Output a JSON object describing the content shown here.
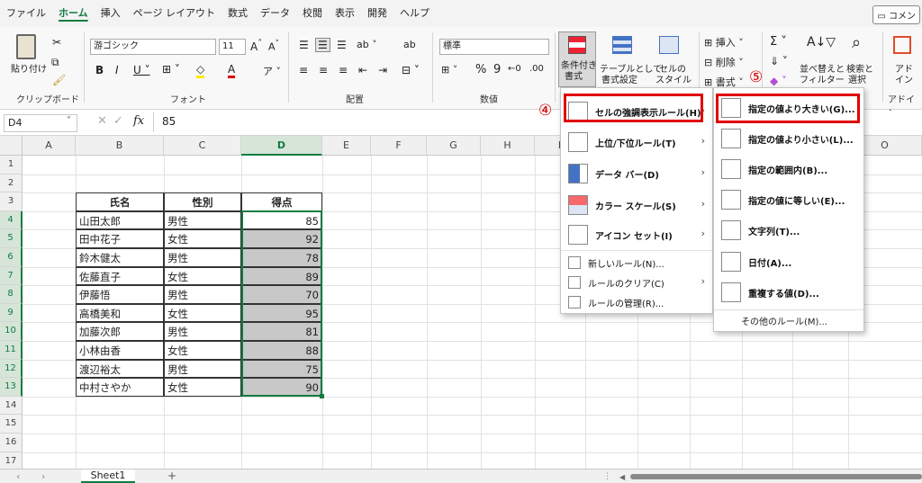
{
  "menu_tabs": [
    "ファイル",
    "ホーム",
    "挿入",
    "ページ レイアウト",
    "数式",
    "データ",
    "校閲",
    "表示",
    "開発",
    "ヘルプ"
  ],
  "comment_label": "コメン",
  "ribbon": {
    "paste": "貼り付け",
    "clipboard": "クリップボード",
    "font_name": "游ゴシック",
    "font_size": "11",
    "font_group": "フォント",
    "align_group": "配置",
    "number_format": "標準",
    "number_group": "数値",
    "cond_format": [
      "条件付き",
      "書式"
    ],
    "table_format": [
      "テーブルとして",
      "書式設定"
    ],
    "cell_style": [
      "セルの",
      "スタイル"
    ],
    "insert": "挿入",
    "delete": "削除",
    "format": "書式",
    "sort_filter": [
      "並べ替えと",
      "フィルター"
    ],
    "find_select": [
      "検索と",
      "選択"
    ],
    "addin": [
      "アド",
      "イン"
    ],
    "addin_group": "アドイン"
  },
  "formula_bar": {
    "name_box": "D4",
    "fx": "fx",
    "value": "85"
  },
  "columns": [
    "A",
    "B",
    "C",
    "D",
    "E",
    "F",
    "G",
    "H",
    "I",
    "J",
    "K",
    "L",
    "M",
    "N",
    "O"
  ],
  "rows": [
    "1",
    "2",
    "3",
    "4",
    "5",
    "6",
    "7",
    "8",
    "9",
    "10",
    "11",
    "12",
    "13",
    "14",
    "15",
    "16",
    "17"
  ],
  "table": {
    "headers": [
      "氏名",
      "性別",
      "得点"
    ],
    "rows": [
      [
        "山田太郎",
        "男性",
        "85"
      ],
      [
        "田中花子",
        "女性",
        "92"
      ],
      [
        "鈴木健太",
        "男性",
        "78"
      ],
      [
        "佐藤直子",
        "女性",
        "89"
      ],
      [
        "伊藤悟",
        "男性",
        "70"
      ],
      [
        "高橋美和",
        "女性",
        "95"
      ],
      [
        "加藤次郎",
        "男性",
        "81"
      ],
      [
        "小林由香",
        "女性",
        "88"
      ],
      [
        "渡辺裕太",
        "男性",
        "75"
      ],
      [
        "中村さやか",
        "女性",
        "90"
      ]
    ]
  },
  "cf_menu": [
    "セルの強調表示ルール(H)",
    "上位/下位ルール(T)",
    "データ バー(D)",
    "カラー スケール(S)",
    "アイコン セット(I)",
    "新しいルール(N)...",
    "ルールのクリア(C)",
    "ルールの管理(R)..."
  ],
  "sub_menu": [
    "指定の値より大きい(G)...",
    "指定の値より小さい(L)...",
    "指定の範囲内(B)...",
    "指定の値に等しい(E)...",
    "文字列(T)...",
    "日付(A)...",
    "重複する値(D)...",
    "その他のルール(M)..."
  ],
  "badges": [
    "④",
    "⑤"
  ],
  "sheet_tab": "Sheet1",
  "add_sheet": "+",
  "colors": {
    "accent": "#107c41",
    "highlight_red": "#e00000",
    "selected_fill": "#c8c8c8"
  }
}
